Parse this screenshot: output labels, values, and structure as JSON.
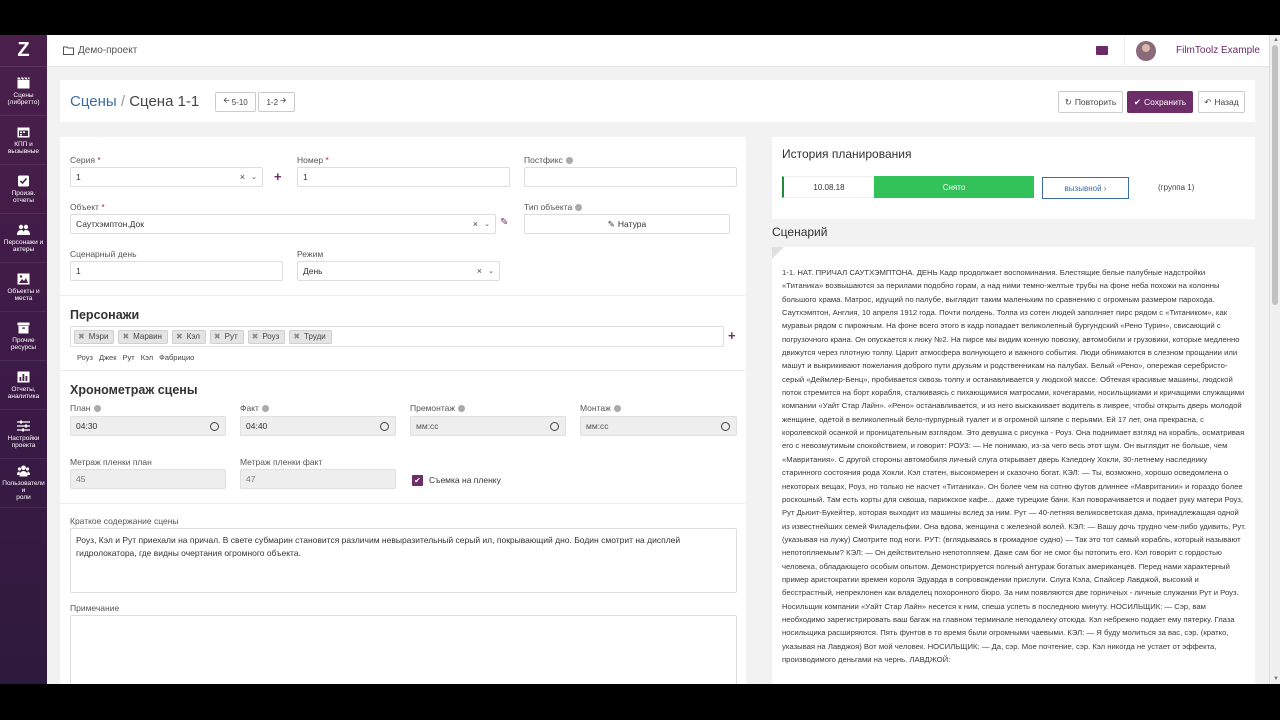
{
  "sidebar": {
    "logo": "Z",
    "items": [
      {
        "label": "Сцены\n(либретто)",
        "icon": "film-icon"
      },
      {
        "label": "КПП и\nвызывные",
        "icon": "calendar-icon"
      },
      {
        "label": "Произв.\nотчеты",
        "icon": "check-icon"
      },
      {
        "label": "Персонажи и\nактеры",
        "icon": "users-icon"
      },
      {
        "label": "Объекты и\nместа",
        "icon": "image-icon"
      },
      {
        "label": "Прочие\nресурсы",
        "icon": "box-icon"
      },
      {
        "label": "Отчеты,\nаналитика",
        "icon": "chart-icon"
      },
      {
        "label": "Настройки\nпроекта",
        "icon": "sliders-icon"
      },
      {
        "label": "Пользователи и\nроли",
        "icon": "team-icon"
      }
    ]
  },
  "header": {
    "breadcrumb": "Демо-проект",
    "user_name": "FilmToolz Example"
  },
  "titlebar": {
    "section": "Сцены",
    "separator": "/",
    "scene": "Сцена 1-1",
    "prev_label": "5-10",
    "next_label": "1-2",
    "repeat_label": "Повторить",
    "save_label": "Сохранить",
    "back_label": "Назад"
  },
  "form": {
    "series_label": "Серия",
    "series_value": "1",
    "number_label": "Номер",
    "number_value": "1",
    "postfix_label": "Постфикс",
    "postfix_value": "",
    "object_label": "Объект",
    "object_value": "Саутхэмптон.Док",
    "object_type_label": "Тип объекта",
    "object_type_value": "Натура",
    "day_label": "Сценарный день",
    "day_value": "1",
    "mode_label": "Режим",
    "mode_value": "День",
    "req": "*",
    "chars_title": "Персонажи",
    "characters": [
      "Мэри",
      "Марвин",
      "Кэл",
      "Рут",
      "Роуз",
      "Труди"
    ],
    "suggestions": [
      "Роуз",
      "Джек",
      "Рут",
      "Кэл",
      "Фабрицио"
    ],
    "timing_title": "Хронометраж сцены",
    "plan_label": "План",
    "plan_value": "04:30",
    "fact_label": "Факт",
    "fact_value": "04:40",
    "premount_label": "Премонтаж",
    "premount_placeholder": "мм:сс",
    "mount_label": "Монтаж",
    "mount_placeholder": "мм:сс",
    "film_plan_label": "Метраж пленки план",
    "film_plan_value": "45",
    "film_fact_label": "Метраж пленки факт",
    "film_fact_value": "47",
    "on_film_label": "Съемка на пленку",
    "on_film_checked": true,
    "summary_label": "Краткое содержание сцены",
    "summary_text": "Роуз, Кэл и Рут приехали на причал. В свете субмарин становится различим невыразительный серый ил, покрывающий дно. Бодин смотрит на дисплей гидролокатора, где видны очертания огромного объекта.",
    "note_label": "Примечание",
    "note_text": ""
  },
  "history": {
    "title": "История планирования",
    "date": "10.08.18",
    "status": "Снято",
    "call_label": "вызывной",
    "group": "(группа 1)"
  },
  "scenario": {
    "title": "Сценарий",
    "text": "1-1. НАТ. ПРИЧАЛ САУТХЭМПТОНА. ДЕНЬ Кадр продолжает воспоминания. Блестящие белые палубные надстройки «Титаника» возвышаются за перилами подобно горам, а над ними темно-желтые трубы на фоне неба похожи на колонны большого храма. Матрос, идущий по палубе, выглядит таким маленьким по сравнению с огромным размером парохода. Саутхэмптон, Англия, 10 апреля 1912 года. Почти полдень. Толпа из сотен людей заполняет пирс рядом с «Титаником», как муравьи рядом с пирожным. На фоне всего этого в кадр попадает великолепный бургундский «Рено Турин», свисающий с погрузочного крана. Он опускается к люку №2. На пирсе мы видим конную повозку, автомобили и грузовики, которые медленно движутся через плотную толпу. Царит атмосфера волнующего и важного события. Люди обнимаются в слезном прощании или машут и выкрикивают пожелания доброго пути друзьям и родственникам на палубах. Белый «Рено», опережая серебристо-серый «Деймлер-Бенц», пробивается сквозь толпу и останавливается у людской массе. Обтекая красивые машины, людской поток стремится на борт корабля, сталкиваясь с пихающимися матросами, кочегарами, носильщиками и кричащими служащими компании «Уайт Стар Лайн». «Рено» останавливается, и из него выскакивает водитель в ливрее, чтобы открыть дверь молодой женщине, одетой в великолепный бело-пурпурный туалет и в огромной шляпе с перьями. Ей 17 лет, она прекрасна, с королевской осанкой и проницательным взглядом. Это девушка с рисунка - Роуз. Она поднимает взгляд на корабль, осматривая его с невозмутимым спокойствием, и говорит: РОУЗ: — Не понимаю, из-за чего весь этот шум. Он выглядит не больше, чем «Мавритания». С другой стороны автомобиля личный слуга открывает дверь Кэледону Хокли, 30-летнему наследнику старинного состояния рода Хокли. Кэл статен, высокомерен и сказочно богат. КЭЛ: — Ты, возможно, хорошо осведомлена о некоторых вещах, Роуз, но только не насчет «Титаника». Он более чем на сотню футов длиннее «Мавритании» и гораздо более роскошный. Там есть корты для сквоша, парижское кафе... даже турецкие бани. Кэл поворачивается и подает руку матери Роуз, Рут Дьюит-Букейтер, которая выходит из машины вслед за ним. Рут — 40-летняя великосветская дама, принадлежащая одной из известнейших семей Филадельфии. Она вдова, женщина с железной волей. КЭЛ: — Вашу дочь трудно чем-либо удивить, Рут. (указывая на лужу) Смотрите под ноги. РУТ: (вглядываясь в громадное судно) — Так это тот самый корабль, который называют непотопляемым? КЭЛ: — Он действительно непотопляем. Даже сам бог не смог бы потопить его. Кэл говорит с гордостью человека, обладающего особым опытом. Демонстрируется полный антураж богатых американцев. Перед нами характерный пример аристократии времен короля Эдуарда в сопровождении прислуги. Слуга Кэла, Спайсер Лавджой, высокий и бесстрастный, непреклонен как владелец похоронного бюро. За ним появляются две горничных - личные служанки Рут и Роуз. Носильщик компании «Уайт Стар Лайн» несется к ним, спеша успеть в последнюю минуту. НОСИЛЬЩИК: — Сэр, вам необходимо зарегистрировать ваш багаж на главном терминале неподалеку отсюда. Кэл небрежно подает ему пятерку. Глаза носильщика расширяются. Пять фунтов в то время были огромными чаевыми. КЭЛ: — Я буду молиться за вас, сэр. (кратко, указывая на Лавджоя) Вот мой человек. НОСИЛЬЩИК: — Да, сэр. Мое почтение, сэр. Кэл никогда не устает от эффекта, производимого деньгами на чернь. ЛАВДЖОЙ:"
  },
  "colors": {
    "accent": "#6d2d68",
    "link": "#3b6ea5",
    "status_green": "#33c15a",
    "sidebar": "#4a1f4b"
  }
}
